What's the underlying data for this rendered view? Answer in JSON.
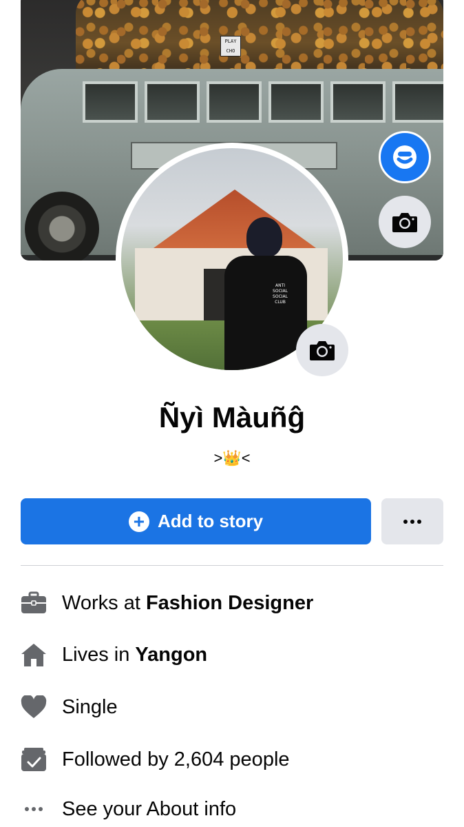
{
  "cover": {
    "tag_text": "PLAY CHO"
  },
  "profile": {
    "name": "Ñyì Màuñĝ",
    "bio": ">👑<",
    "shirt_text": "ANTI SOCIAL SOCIAL CLUB"
  },
  "actions": {
    "add_story_label": "Add to story",
    "more_icon": "more-dots-icon"
  },
  "intro": {
    "work_prefix": "Works at ",
    "work_value": "Fashion Designer",
    "lives_prefix": "Lives in ",
    "lives_value": "Yangon",
    "relationship": "Single",
    "followers": "Followed by 2,604 people",
    "about_link": "See your About info"
  },
  "colors": {
    "primary": "#1b74e4",
    "secondary_button": "#e4e6eb",
    "icon_gray": "#65676b",
    "text": "#050505"
  }
}
